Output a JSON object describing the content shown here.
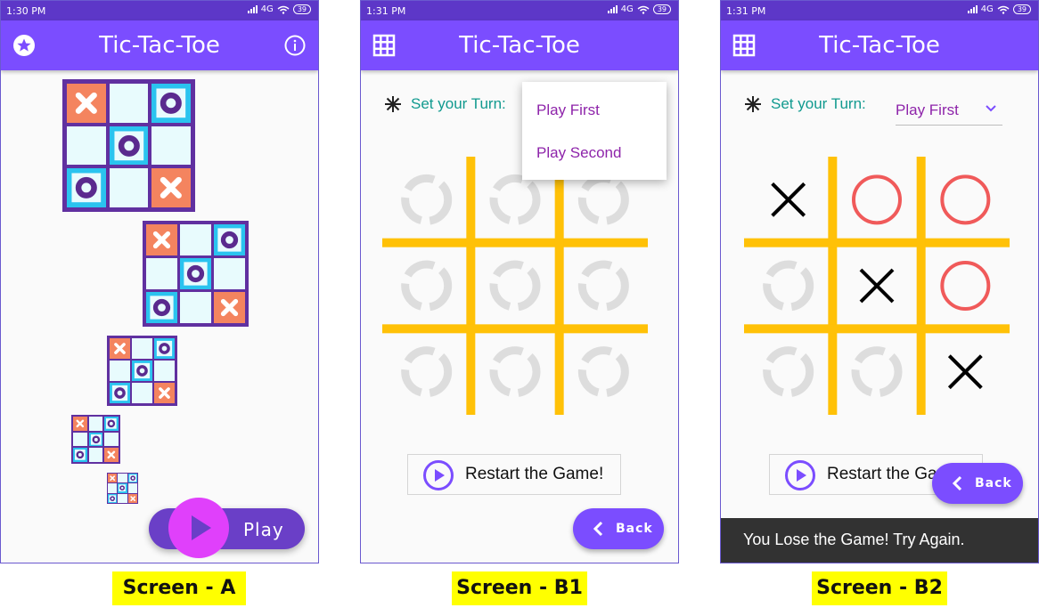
{
  "screen_a": {
    "status_time": "1:30 PM",
    "status_network": "4G",
    "battery": "39",
    "title": "Tic-Tac-Toe",
    "left_icon": "star-icon",
    "right_icon": "info-icon",
    "play_label": "Play",
    "caption": "Screen - A",
    "boards": [
      [
        "x",
        "",
        "o",
        "",
        "o",
        "",
        "o",
        "",
        "x"
      ],
      [
        "x",
        "",
        "o",
        "",
        "o",
        "",
        "o",
        "",
        "x"
      ],
      [
        "x",
        "",
        "o",
        "",
        "o",
        "",
        "o",
        "",
        "x"
      ],
      [
        "x",
        "",
        "o",
        "",
        "o",
        "",
        "o",
        "",
        "x"
      ],
      [
        "x",
        "",
        "o",
        "",
        "o",
        "",
        "o",
        "",
        "x"
      ]
    ]
  },
  "screen_b1": {
    "status_time": "1:31 PM",
    "status_network": "4G",
    "battery": "39",
    "title": "Tic-Tac-Toe",
    "left_icon": "grid-icon",
    "turn_label": "Set your Turn:",
    "menu_options": [
      "Play First",
      "Play Second"
    ],
    "board": [
      "",
      "",
      "",
      "",
      "",
      "",
      "",
      "",
      ""
    ],
    "restart_label": "Restart the Game!",
    "back_label": "Back",
    "caption": "Screen - B1"
  },
  "screen_b2": {
    "status_time": "1:31 PM",
    "status_network": "4G",
    "battery": "39",
    "title": "Tic-Tac-Toe",
    "left_icon": "grid-icon",
    "turn_label": "Set your Turn:",
    "selected_turn": "Play First",
    "board": [
      "x",
      "o",
      "o",
      "",
      "x",
      "o",
      "",
      "",
      "x"
    ],
    "restart_label": "Restart the Game!",
    "back_label": "Back",
    "snackbar": "You Lose the Game! Try Again.",
    "caption": "Screen - B2"
  },
  "colors": {
    "status_bar": "#5d37c8",
    "app_bar": "#7b4dff",
    "grid_lines": "#ffc107",
    "x_mark": "#000000",
    "o_mark": "#f05a5a",
    "empty_mark": "#dddddd",
    "turn_text": "#119a8f",
    "menu_text": "#8e24aa",
    "caption_bg": "#ffff00"
  }
}
